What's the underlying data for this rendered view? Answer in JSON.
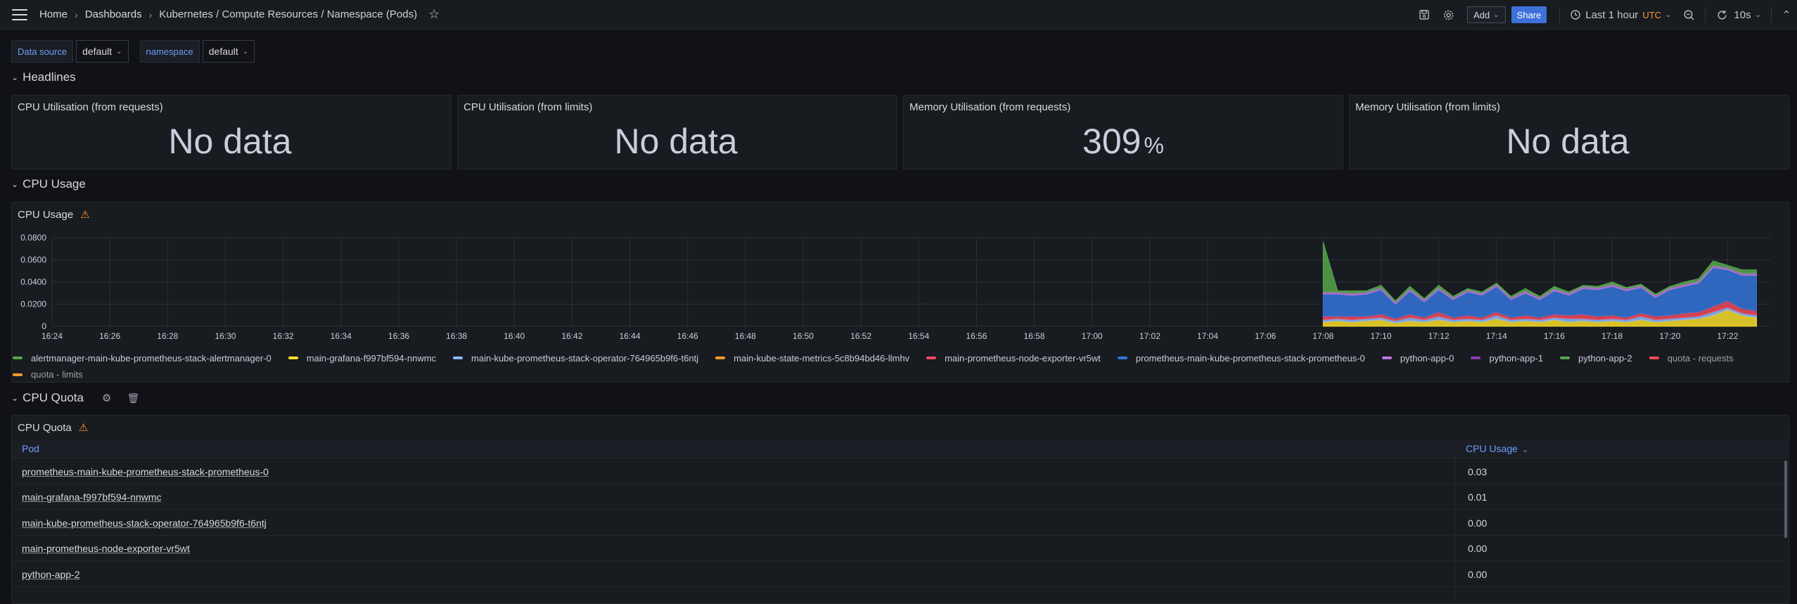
{
  "header": {
    "breadcrumb": [
      "Home",
      "Dashboards",
      "Kubernetes / Compute Resources / Namespace (Pods)"
    ],
    "add_label": "Add",
    "share_label": "Share",
    "time_range": "Last 1 hour",
    "timezone": "UTC",
    "refresh": "10s"
  },
  "variables": [
    {
      "label": "Data source",
      "value": "default"
    },
    {
      "label": "namespace",
      "value": "default"
    }
  ],
  "rows": {
    "headlines": "Headlines",
    "cpu_usage": "CPU Usage",
    "cpu_quota": "CPU Quota"
  },
  "stats": [
    {
      "title": "CPU Utilisation (from requests)",
      "value": "No data",
      "unit": ""
    },
    {
      "title": "CPU Utilisation (from limits)",
      "value": "No data",
      "unit": ""
    },
    {
      "title": "Memory Utilisation (from requests)",
      "value": "309",
      "unit": "%"
    },
    {
      "title": "Memory Utilisation (from limits)",
      "value": "No data",
      "unit": ""
    }
  ],
  "cpu_panel_title": "CPU Usage",
  "chart_data": {
    "type": "area",
    "stacked": true,
    "ylim": [
      0,
      0.08
    ],
    "y_ticks": [
      "0.0800",
      "0.0600",
      "0.0400",
      "0.0200",
      "0"
    ],
    "x_ticks": [
      "16:24",
      "16:26",
      "16:28",
      "16:30",
      "16:32",
      "16:34",
      "16:36",
      "16:38",
      "16:40",
      "16:42",
      "16:44",
      "16:46",
      "16:48",
      "16:50",
      "16:52",
      "16:54",
      "16:56",
      "16:58",
      "17:00",
      "17:02",
      "17:04",
      "17:06",
      "17:08",
      "17:10",
      "17:12",
      "17:14",
      "17:16",
      "17:18",
      "17:20",
      "17:22"
    ],
    "x": [
      "17:08",
      "17:08:30",
      "17:09",
      "17:09:30",
      "17:10",
      "17:10:30",
      "17:11",
      "17:11:30",
      "17:12",
      "17:12:30",
      "17:13",
      "17:13:30",
      "17:14",
      "17:14:30",
      "17:15",
      "17:15:30",
      "17:16",
      "17:16:30",
      "17:17",
      "17:17:30",
      "17:18",
      "17:18:30",
      "17:19",
      "17:19:30",
      "17:20",
      "17:20:30",
      "17:21",
      "17:21:30",
      "17:22",
      "17:22:30",
      "17:23"
    ],
    "series": [
      {
        "name": "main-grafana-f997bf594-nnwmc",
        "color": "#fade2a",
        "values": [
          0.004,
          0.005,
          0.004,
          0.005,
          0.006,
          0.003,
          0.005,
          0.004,
          0.006,
          0.004,
          0.005,
          0.004,
          0.007,
          0.004,
          0.005,
          0.004,
          0.006,
          0.004,
          0.005,
          0.004,
          0.005,
          0.004,
          0.006,
          0.004,
          0.005,
          0.006,
          0.007,
          0.01,
          0.015,
          0.01,
          0.008
        ]
      },
      {
        "name": "main-kube-prometheus-stack-operator-764965b9f6-t6ntj",
        "color": "#8ab8ff",
        "values": [
          0.002,
          0.002,
          0.002,
          0.002,
          0.002,
          0.002,
          0.003,
          0.002,
          0.003,
          0.002,
          0.002,
          0.002,
          0.003,
          0.002,
          0.002,
          0.002,
          0.002,
          0.003,
          0.002,
          0.002,
          0.002,
          0.002,
          0.003,
          0.002,
          0.002,
          0.002,
          0.002,
          0.003,
          0.002,
          0.002,
          0.002
        ]
      },
      {
        "name": "main-prometheus-node-exporter-vr5wt",
        "color": "#f2495c",
        "values": [
          0.003,
          0.002,
          0.003,
          0.002,
          0.003,
          0.002,
          0.003,
          0.002,
          0.004,
          0.002,
          0.003,
          0.002,
          0.003,
          0.002,
          0.003,
          0.002,
          0.003,
          0.003,
          0.004,
          0.003,
          0.003,
          0.002,
          0.003,
          0.003,
          0.003,
          0.004,
          0.004,
          0.005,
          0.006,
          0.004,
          0.004
        ]
      },
      {
        "name": "prometheus-main-kube-prometheus-stack-prometheus-0",
        "color": "#3274d9",
        "values": [
          0.02,
          0.02,
          0.019,
          0.02,
          0.022,
          0.013,
          0.021,
          0.014,
          0.02,
          0.016,
          0.021,
          0.02,
          0.023,
          0.016,
          0.02,
          0.016,
          0.021,
          0.018,
          0.023,
          0.024,
          0.026,
          0.024,
          0.023,
          0.017,
          0.023,
          0.024,
          0.026,
          0.035,
          0.028,
          0.03,
          0.032
        ]
      },
      {
        "name": "python-app-0",
        "color": "#b877d9",
        "values": [
          0.002,
          0.002,
          0.002,
          0.002,
          0.002,
          0.002,
          0.002,
          0.002,
          0.002,
          0.002,
          0.002,
          0.002,
          0.002,
          0.002,
          0.002,
          0.002,
          0.002,
          0.002,
          0.002,
          0.002,
          0.002,
          0.002,
          0.002,
          0.002,
          0.002,
          0.002,
          0.002,
          0.002,
          0.002,
          0.002,
          0.002
        ]
      },
      {
        "name": "python-app-2",
        "color": "#56a64b",
        "values": [
          0.045,
          0.001,
          0.002,
          0.001,
          0.002,
          0.001,
          0.002,
          0.001,
          0.002,
          0.001,
          0.001,
          0.001,
          0.001,
          0.001,
          0.002,
          0.001,
          0.002,
          0.001,
          0.001,
          0.001,
          0.002,
          0.001,
          0.001,
          0.001,
          0.001,
          0.002,
          0.002,
          0.004,
          0.002,
          0.003,
          0.003
        ]
      }
    ],
    "legend": [
      {
        "name": "alertmanager-main-kube-prometheus-stack-alertmanager-0",
        "color": "#56a64b"
      },
      {
        "name": "main-grafana-f997bf594-nnwmc",
        "color": "#fade2a"
      },
      {
        "name": "main-kube-prometheus-stack-operator-764965b9f6-t6ntj",
        "color": "#8ab8ff"
      },
      {
        "name": "main-kube-state-metrics-5c8b94bd46-llmhv",
        "color": "#ff9830"
      },
      {
        "name": "main-prometheus-node-exporter-vr5wt",
        "color": "#f2495c"
      },
      {
        "name": "prometheus-main-kube-prometheus-stack-prometheus-0",
        "color": "#3274d9"
      },
      {
        "name": "python-app-0",
        "color": "#b877d9"
      },
      {
        "name": "python-app-1",
        "color": "#8f3bb8"
      },
      {
        "name": "python-app-2",
        "color": "#56a64b"
      },
      {
        "name": "quota - requests",
        "color": "#f2495c",
        "dim": true
      },
      {
        "name": "quota - limits",
        "color": "#ff9830",
        "dim": true
      }
    ]
  },
  "quota_panel_title": "CPU Quota",
  "table": {
    "columns": [
      "Pod",
      "CPU Usage"
    ],
    "rows": [
      {
        "pod": "prometheus-main-kube-prometheus-stack-prometheus-0",
        "cpu": "0.03"
      },
      {
        "pod": "main-grafana-f997bf594-nnwmc",
        "cpu": "0.01"
      },
      {
        "pod": "main-kube-prometheus-stack-operator-764965b9f6-t6ntj",
        "cpu": "0.00"
      },
      {
        "pod": "main-prometheus-node-exporter-vr5wt",
        "cpu": "0.00"
      },
      {
        "pod": "python-app-2",
        "cpu": "0.00"
      }
    ]
  }
}
